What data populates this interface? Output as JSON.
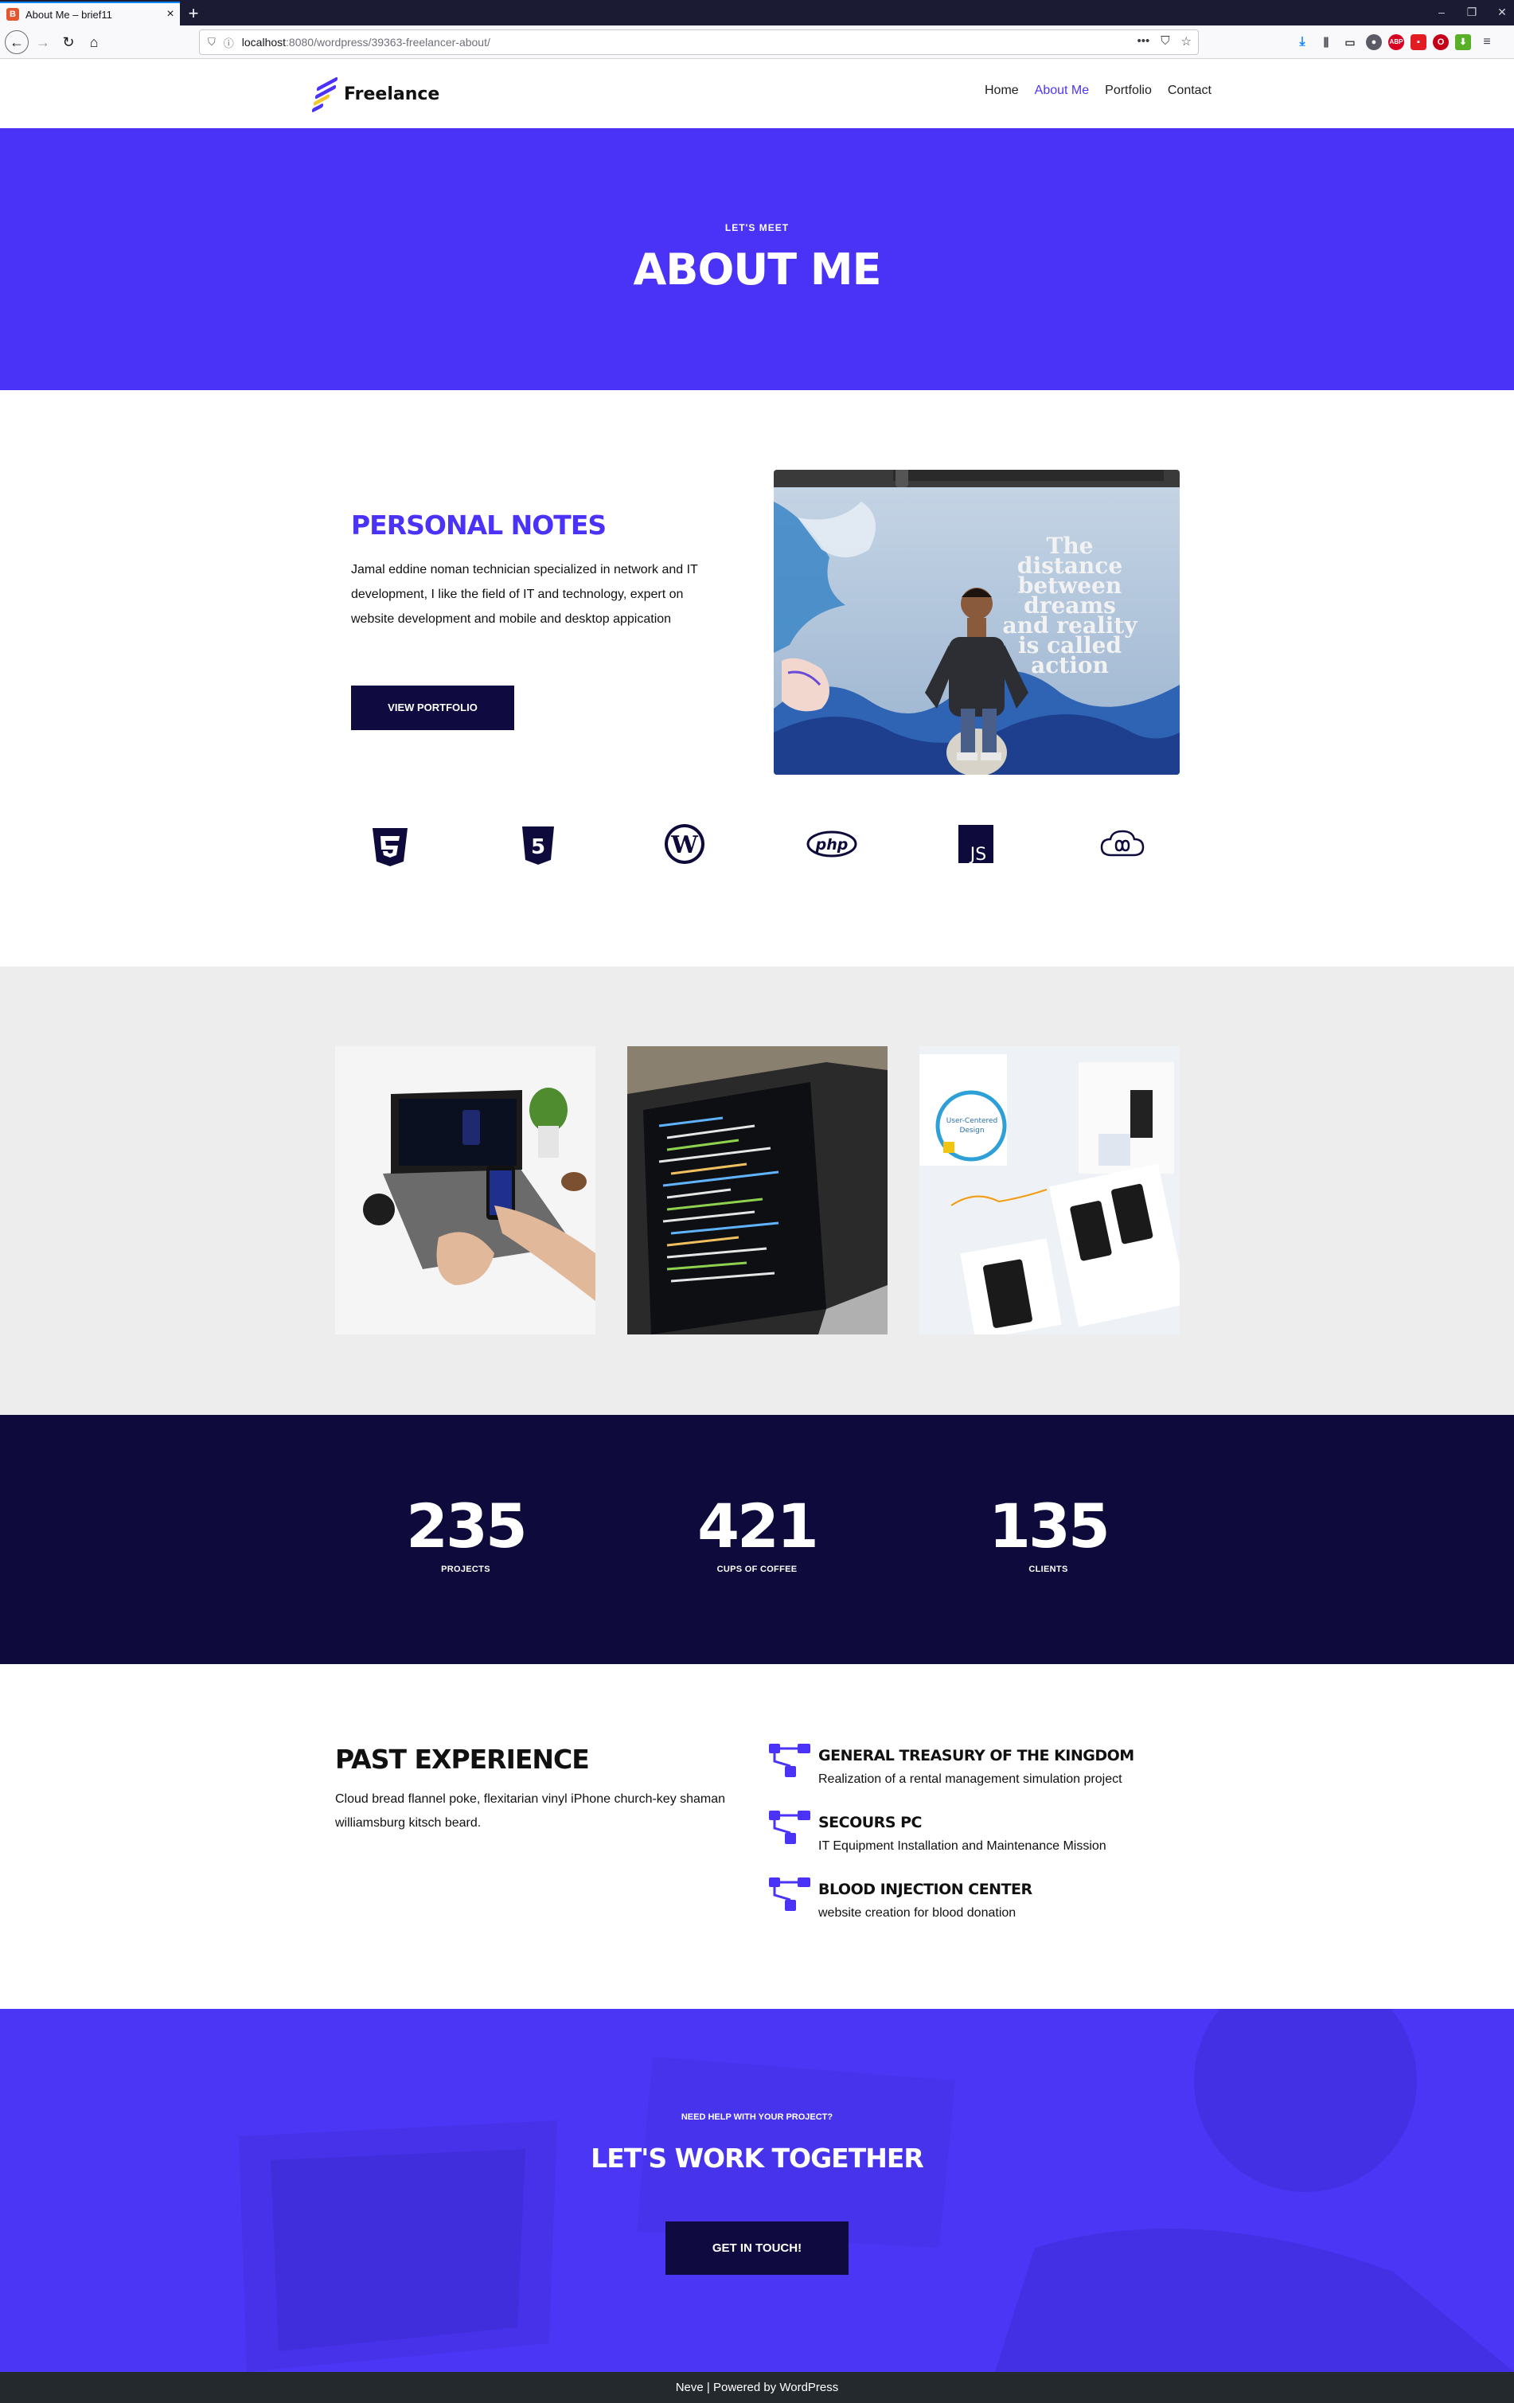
{
  "browser": {
    "tab_title": "About Me – brief11",
    "favicon": "B",
    "new_tab": "+",
    "url_host": "localhost",
    "url_path": ":8080/wordpress/39363-freelancer-about/",
    "window_controls": [
      "–",
      "❐",
      "✕"
    ]
  },
  "site": {
    "logo_text": "Freelance",
    "nav": [
      {
        "label": "Home"
      },
      {
        "label": "About Me"
      },
      {
        "label": "Portfolio"
      },
      {
        "label": "Contact"
      }
    ]
  },
  "hero": {
    "kicker": "LET'S MEET",
    "title": "ABOUT ME"
  },
  "notes": {
    "title": "PERSONAL NOTES",
    "text": "Jamal eddine noman technician specialized in network and IT development, I like the field of IT and technology, expert on website development and mobile and desktop appication",
    "button": "VIEW PORTFOLIO",
    "photo_quote": [
      "The",
      "distance",
      "between",
      "dreams",
      "and reality",
      "is called",
      "action"
    ]
  },
  "tech_icons": [
    "css3-icon",
    "html5-icon",
    "wordpress-icon",
    "php-icon",
    "js-icon",
    "infinity-cloud-icon"
  ],
  "tech_js_label": "JS",
  "tech_php_label": "php",
  "counters": [
    {
      "value": "235",
      "label": "PROJECTS"
    },
    {
      "value": "421",
      "label": "CUPS OF COFFEE"
    },
    {
      "value": "135",
      "label": "CLIENTS"
    }
  ],
  "experience": {
    "title": "PAST EXPERIENCE",
    "text": "Cloud bread flannel poke, flexitarian vinyl iPhone church-key shaman williamsburg kitsch beard.",
    "items": [
      {
        "title": "GENERAL TREASURY OF THE KINGDOM",
        "desc": "Realization of a rental management simulation project"
      },
      {
        "title": "SECOURS PC",
        "desc": "IT Equipment Installation and Maintenance Mission"
      },
      {
        "title": "BLOOD INJECTION CENTER",
        "desc": "website creation for blood donation"
      }
    ]
  },
  "cta": {
    "kicker": "NEED HELP WITH YOUR PROJECT?",
    "title": "LET'S WORK TOGETHER",
    "button": "GET IN TOUCH!"
  },
  "footer": {
    "text": "Neve | Powered by WordPress"
  },
  "colors": {
    "accent": "#4a33f7",
    "dark": "#0e0b3c",
    "footer": "#24292e"
  }
}
